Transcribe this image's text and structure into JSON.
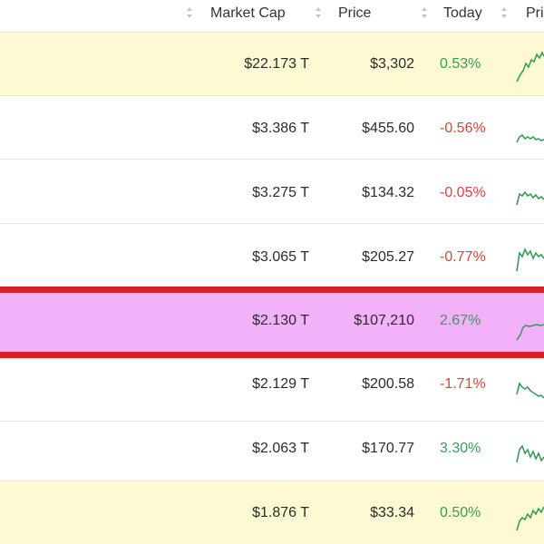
{
  "header": {
    "columns": [
      {
        "key": "market_cap",
        "label": "Market Cap"
      },
      {
        "key": "price",
        "label": "Price"
      },
      {
        "key": "today",
        "label": "Today"
      },
      {
        "key": "price_chart",
        "label": "Pric"
      }
    ]
  },
  "rows": [
    {
      "market_cap": "$22.173 T",
      "price": "$3,302",
      "today": "0.53%",
      "direction": "up",
      "highlight": "yellow"
    },
    {
      "market_cap": "$3.386 T",
      "price": "$455.60",
      "today": "-0.56%",
      "direction": "down",
      "highlight": "none"
    },
    {
      "market_cap": "$3.275 T",
      "price": "$134.32",
      "today": "-0.05%",
      "direction": "down",
      "highlight": "none"
    },
    {
      "market_cap": "$3.065 T",
      "price": "$205.27",
      "today": "-0.77%",
      "direction": "down",
      "highlight": "none"
    },
    {
      "market_cap": "$2.130 T",
      "price": "$107,210",
      "today": "2.67%",
      "direction": "up",
      "highlight": "pink",
      "selected": true
    },
    {
      "market_cap": "$2.129 T",
      "price": "$200.58",
      "today": "-1.71%",
      "direction": "down",
      "highlight": "none"
    },
    {
      "market_cap": "$2.063 T",
      "price": "$170.77",
      "today": "3.30%",
      "direction": "up",
      "highlight": "none"
    },
    {
      "market_cap": "$1.876 T",
      "price": "$33.34",
      "today": "0.50%",
      "direction": "up",
      "highlight": "yellow"
    }
  ],
  "colors": {
    "positive": "#3b9b5a",
    "negative": "#d1463f",
    "highlight_yellow": "#fdfad3",
    "highlight_pink": "#f2b1f8",
    "selection_border": "#dc1f26",
    "sparkline": "#3b9b5a"
  }
}
